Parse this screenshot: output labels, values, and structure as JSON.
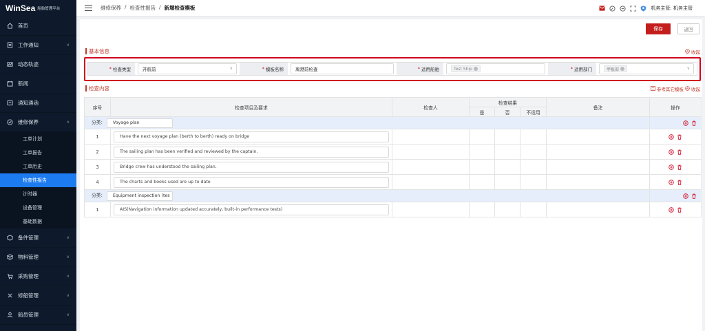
{
  "app": {
    "logo": "WinSea",
    "subtitle": "船舶管理平台"
  },
  "sidebar": {
    "items": [
      {
        "label": "首页"
      },
      {
        "label": "工作通知"
      },
      {
        "label": "动态轨迹"
      },
      {
        "label": "新闻"
      },
      {
        "label": "通知通函"
      },
      {
        "label": "维修保养"
      },
      {
        "label": "备件管理"
      },
      {
        "label": "物料管理"
      },
      {
        "label": "采购管理"
      },
      {
        "label": "修船管理"
      },
      {
        "label": "船员管理"
      }
    ],
    "sub_items": [
      {
        "label": "工单计划"
      },
      {
        "label": "工单报告"
      },
      {
        "label": "工单历史"
      },
      {
        "label": "检查性报告"
      },
      {
        "label": "计时器"
      },
      {
        "label": "设备管理"
      },
      {
        "label": "基础数据"
      }
    ]
  },
  "header": {
    "breadcrumb": [
      "维修保养",
      "检查性报告",
      "新增检查模板"
    ],
    "separator": "/",
    "user": "机务主管: 机务主管"
  },
  "toolbar": {
    "save": "保存",
    "back": "返回"
  },
  "basic": {
    "title": "基本信息",
    "collapse": "收起",
    "fields": {
      "type_label": "检查类型",
      "type_value": "开航前",
      "name_label": "模板名称",
      "name_value": "离港前检查",
      "scope_label": "适用船舶",
      "scope_tag": "Test Ship",
      "dept_label": "适用部门",
      "dept_tag": "甲板部"
    }
  },
  "content": {
    "title": "检查内容",
    "ref_link": "参考其它模板",
    "collapse": "收起",
    "columns": {
      "seq": "序号",
      "item": "检查项目及要求",
      "inspector": "检查人",
      "result": "检查结果",
      "yes": "是",
      "no": "否",
      "na": "不适用",
      "remark": "备注",
      "op": "操作"
    },
    "category_label": "分类:",
    "groups": [
      {
        "name": "Voyage plan",
        "rows": [
          {
            "seq": "1",
            "text": "Have the next voyage plan (berth to berth) ready on bridge"
          },
          {
            "seq": "2",
            "text": "The sailing plan has been verified and reviewed by the captain."
          },
          {
            "seq": "3",
            "text": "Bridge crew has understood the sailing plan."
          },
          {
            "seq": "4",
            "text": "The charts and books used are up to date"
          }
        ]
      },
      {
        "name": "Equipment inspection (tes",
        "rows": [
          {
            "seq": "1",
            "text": "AIS(Navigation information updated accurately, built-in performance tests)"
          }
        ]
      }
    ]
  },
  "colors": {
    "accent": "#c41d1d",
    "sidebar": "#0e1a2b",
    "active": "#1d7bf0",
    "group_bg": "#e6eefb"
  }
}
